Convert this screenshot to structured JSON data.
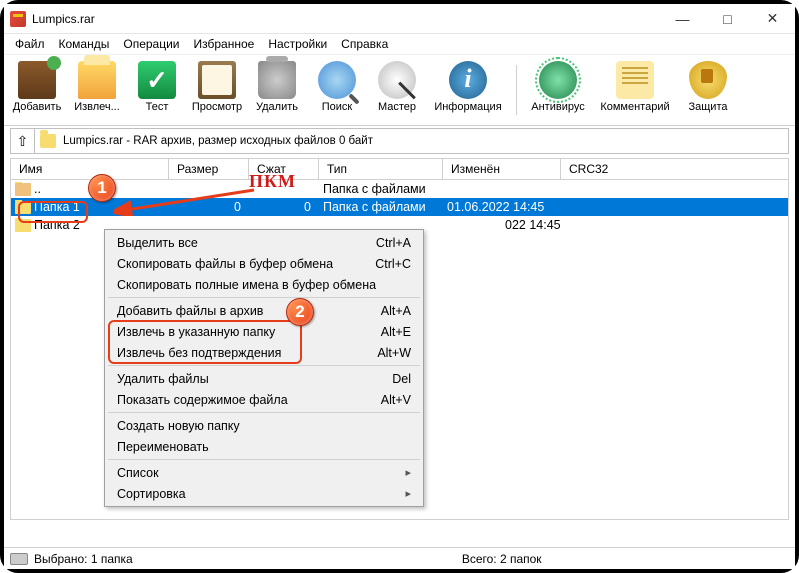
{
  "titlebar": {
    "title": "Lumpics.rar"
  },
  "menu": {
    "items": [
      "Файл",
      "Команды",
      "Операции",
      "Избранное",
      "Настройки",
      "Справка"
    ]
  },
  "toolbar": {
    "add": "Добавить",
    "extract": "Извлеч...",
    "test": "Тест",
    "view": "Просмотр",
    "delete": "Удалить",
    "find": "Поиск",
    "wizard": "Мастер",
    "info": "Информация",
    "virus": "Антивирус",
    "comment": "Комментарий",
    "protect": "Защита"
  },
  "address": {
    "path": "Lumpics.rar - RAR архив, размер исходных файлов 0 байт"
  },
  "columns": {
    "name": "Имя",
    "size": "Размер",
    "packed": "Сжат",
    "type": "Тип",
    "modified": "Изменён",
    "crc": "CRC32"
  },
  "rows": {
    "up": {
      "name": "..",
      "type": "Папка с файлами"
    },
    "r1": {
      "name": "Папка 1",
      "size": "0",
      "packed": "0",
      "type": "Папка с файлами",
      "modified": "01.06.2022 14:45"
    },
    "r2": {
      "name": "Папка 2",
      "modified": "022 14:45"
    }
  },
  "ctx": {
    "select_all": "Выделить все",
    "select_all_k": "Ctrl+A",
    "copy_files": "Скопировать файлы в буфер обмена",
    "copy_files_k": "Ctrl+C",
    "copy_names": "Скопировать полные имена в буфер обмена",
    "add": "Добавить файлы в архив",
    "add_k": "Alt+A",
    "extract_to": "Извлечь в указанную папку",
    "extract_to_k": "Alt+E",
    "extract_noconf": "Извлечь без подтверждения",
    "extract_noconf_k": "Alt+W",
    "delete": "Удалить файлы",
    "delete_k": "Del",
    "show": "Показать содержимое файла",
    "show_k": "Alt+V",
    "newfolder": "Создать новую папку",
    "rename": "Переименовать",
    "list": "Список",
    "sort": "Сортировка"
  },
  "status": {
    "left": "Выбрано: 1 папка",
    "right": "Всего: 2 папок"
  },
  "annot": {
    "badge1": "1",
    "badge2": "2",
    "pkm": "ПКМ"
  }
}
